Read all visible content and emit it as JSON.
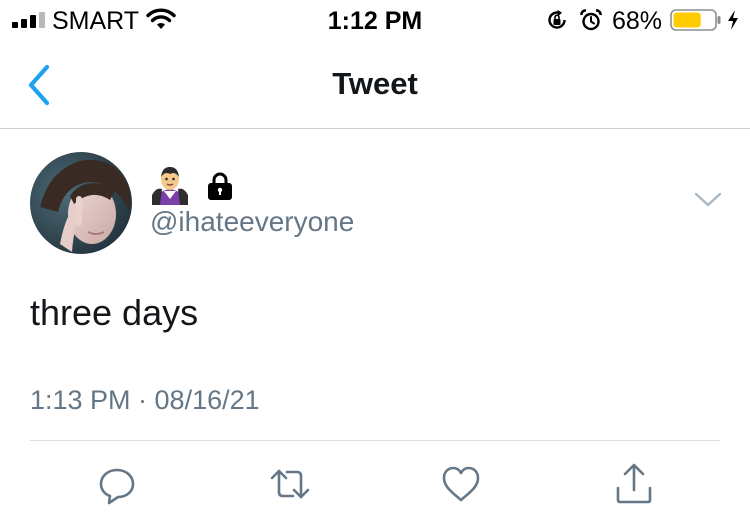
{
  "status_bar": {
    "carrier": "SMART",
    "time": "1:12 PM",
    "battery_percent": "68%",
    "battery_level": 0.68,
    "battery_color": "#ffcc00",
    "icons": [
      "signal-icon",
      "wifi-icon",
      "rotation-lock-icon",
      "alarm-icon",
      "battery-icon",
      "charging-bolt-icon"
    ]
  },
  "nav": {
    "title": "Tweet",
    "back_icon": "chevron-left-icon",
    "accent": "#1da1f2"
  },
  "tweet": {
    "display_name_emojis": [
      "vampire-emoji",
      "lock-emoji"
    ],
    "handle": "@ihateeveryone",
    "text": "three days",
    "time": "1:13 PM",
    "separator": "·",
    "date": "08/16/21",
    "meta_line": "1:13 PM · 08/16/21",
    "menu_icon": "chevron-down-icon"
  },
  "actions": [
    {
      "name": "reply",
      "icon": "reply-icon"
    },
    {
      "name": "retweet",
      "icon": "retweet-icon"
    },
    {
      "name": "like",
      "icon": "heart-icon"
    },
    {
      "name": "share",
      "icon": "share-icon"
    }
  ],
  "colors": {
    "text_primary": "#14171a",
    "text_secondary": "#657786",
    "divider": "#dadde1"
  }
}
